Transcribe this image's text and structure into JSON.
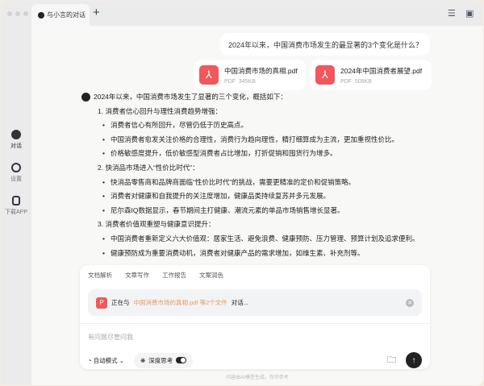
{
  "tab": {
    "title": "与小言的对话",
    "new_tab": "+"
  },
  "sidebar": [
    {
      "label": "对话",
      "icon": "chat-icon"
    },
    {
      "label": "设置",
      "icon": "settings-icon"
    },
    {
      "label": "下载APP",
      "icon": "download-app-icon"
    }
  ],
  "question": "2024年以来，中国消费市场发生的最显著的3个变化是什么？",
  "files": [
    {
      "name": "中国消费市场的真相.pdf",
      "type": "PDF",
      "size": "345KB"
    },
    {
      "name": "2024年中国消费者展望.pdf",
      "type": "PDF",
      "size": "509KB"
    }
  ],
  "answer": {
    "intro": "2024年以来，中国消费市场发生了显著的三个变化，概括如下：",
    "sections": [
      {
        "title": "1. 消费者信心回升与理性消费趋势增强：",
        "items": [
          "消费者信心有所回升，尽管仍低于历史高点。",
          "中国消费者愈发关注价格的合理性，消费行为趋向理性，精打细算成为主流，更加重视性价比。",
          "价格敏感度提升，低价敏感型消费者占比增加，打折促销和囤货行为增多。"
        ]
      },
      {
        "title": "2. 快消品市场进入“性价比时代”：",
        "items": [
          "快消品零售商和品牌商面临“性价比时代”的挑战，需要更精准的定价和促销策略。",
          "消费者对健康和自我提升的关注度增加，健康品类持续复苏并多元发展。",
          "尼尔森IQ数据显示，春节期间主打健康、潮流元素的单品市场销售增长显著。"
        ]
      },
      {
        "title": "3. 消费者价值观重塑与健康意识提升：",
        "items": [
          "中国消费者重新定义六大价值观：居家生活、避免浪费、健康预防、压力管理、预算计划及追求便利。",
          "健康预防成为重要消费动机，消费者对健康产品的需求增加，如维生素、补充剂等。"
        ]
      }
    ]
  },
  "tools": [
    "文档解析",
    "文章写作",
    "工作报告",
    "文案润色"
  ],
  "context": {
    "prefix": "正在与",
    "file": "中国消费市场的真相.pdf 等2个文件",
    "suffix": "对话..."
  },
  "input": {
    "placeholder": "有问题尽管问我"
  },
  "mode": "自动模式",
  "deep_think": "深度思考",
  "footer": "内容由AI模型生成，仅作参考"
}
